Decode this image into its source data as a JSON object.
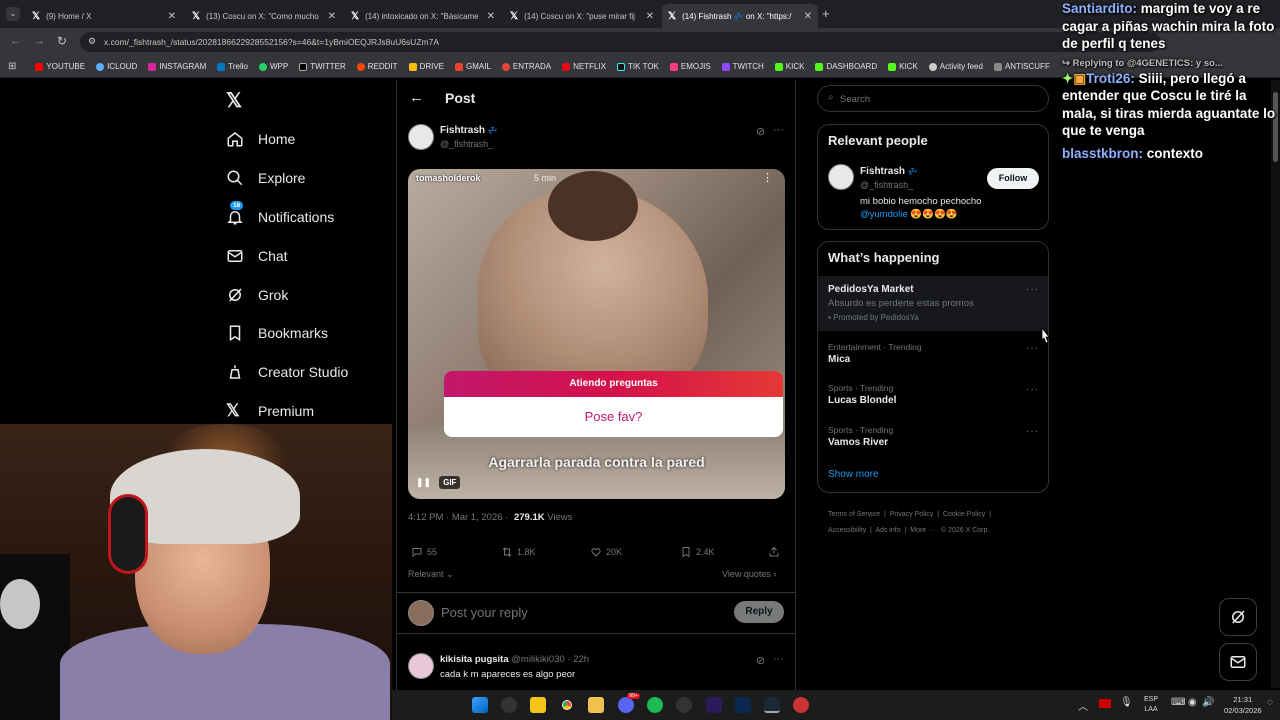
{
  "browser": {
    "tabs": [
      {
        "title": "(9) Home / X"
      },
      {
        "title": "(13) Coscu on X: \"Como mucho"
      },
      {
        "title": "(14) intoxicado on X: \"Básicame"
      },
      {
        "title": "(14) Coscu on X: \"puse mirar fij"
      },
      {
        "title": "(14) Fishtrash 💤 on X: \"https:/"
      }
    ],
    "url": "x.com/_fishtrash_/status/2028186622928552156?s=46&t=1yBmiOEQJRJs8uU6sUZm7A",
    "bookmarks": [
      "YOUTUBE",
      "ICLOUD",
      "INSTAGRAM",
      "Trello",
      "WPP",
      "TWITTER",
      "REDDIT",
      "DRIVE",
      "GMAIL",
      "ENTRADA",
      "NETFLIX",
      "TIK TOK",
      "EMOJIS",
      "TWITCH",
      "KICK",
      "DASHBOARD",
      "KICK",
      "Activity feed",
      "ANTISCUFF"
    ]
  },
  "nav": {
    "items": [
      {
        "label": "Home"
      },
      {
        "label": "Explore"
      },
      {
        "label": "Notifications",
        "badge": "16"
      },
      {
        "label": "Chat"
      },
      {
        "label": "Grok"
      },
      {
        "label": "Bookmarks"
      },
      {
        "label": "Creator Studio"
      },
      {
        "label": "Premium"
      }
    ]
  },
  "post": {
    "header_title": "Post",
    "author_name": "Fishtrash",
    "author_emoji": "💤",
    "author_handle": "@_fishtrash_",
    "media_username": "tomasholderok",
    "media_time": "5 min",
    "sticker_title": "Atiendo preguntas",
    "sticker_question": "Pose fav?",
    "media_caption": "Agarrarla parada contra la pared",
    "gif_label": "GIF",
    "timestamp": "4:12 PM · Mar 1, 2026 ·",
    "views_count": "279.1K",
    "views_label": "Views",
    "replies": "55",
    "reposts": "1.8K",
    "likes": "20K",
    "bookmarks": "2.4K",
    "sort_label": "Relevant",
    "view_quotes": "View quotes",
    "reply_placeholder": "Post your reply",
    "reply_button": "Reply",
    "comment": {
      "name": "kikisita pugsita",
      "handle": "@milikiki030",
      "age": "· 22h",
      "text": "cada k m apareces es algo peor"
    }
  },
  "sidebar": {
    "search_placeholder": "Search",
    "relevant_title": "Relevant people",
    "person": {
      "name": "Fishtrash",
      "handle": "@_fishtrash_",
      "bio": "mi bobio hemocho pechocho",
      "mention": "@yumdolie",
      "bio_emoji": "😍😍😍😍",
      "follow": "Follow"
    },
    "happening_title": "What’s happening",
    "promo": {
      "title": "PedidosYa Market",
      "text": "Absurdo es perderte estas promos",
      "promoted": "Promoted by PedidosYa"
    },
    "trends": [
      {
        "context": "Entertainment · Trending",
        "topic": "Mica"
      },
      {
        "context": "Sports · Trending",
        "topic": "Lucas Blondel"
      },
      {
        "context": "Sports · Trending",
        "topic": "Vamos River"
      }
    ],
    "show_more": "Show more",
    "footer": [
      "Terms of Service",
      "Privacy Policy",
      "Cookie Policy",
      "Accessibility",
      "Ads info",
      "More ···",
      "© 2026 X Corp."
    ]
  },
  "chat": {
    "messages": [
      {
        "user": "Santiardito:",
        "text": "margim te voy a re cagar a piñas wachin mira la foto de perfil q tenes"
      },
      {
        "user": "Replying to @4GENETICS:",
        "text": "y so..."
      },
      {
        "user": "Troti26:",
        "text": "Siiii, pero llegó a entender que Coscu le tiré la mala, si tiras mierda aguantate lo que te venga"
      },
      {
        "user": "blasstkbron:",
        "text": "contexto"
      }
    ]
  },
  "taskbar": {
    "lang": "ESP",
    "lang2": "LAA",
    "time": "21:31",
    "date": "02/03/2026",
    "badge": "99+"
  }
}
